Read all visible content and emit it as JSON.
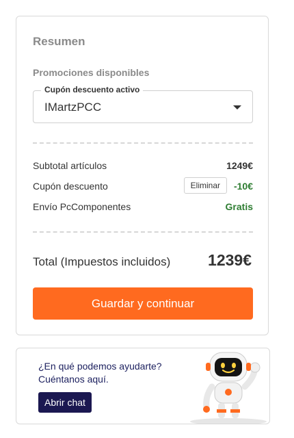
{
  "summary": {
    "title": "Resumen",
    "promotions_label": "Promociones disponibles",
    "coupon_select": {
      "legend": "Cupón descuento activo",
      "value": "IMartzPCC",
      "caret_icon": "chevron-down-icon"
    },
    "rows": {
      "subtotal": {
        "label": "Subtotal artículos",
        "value": "1249€"
      },
      "coupon": {
        "label": "Cupón descuento",
        "remove_label": "Eliminar",
        "value": "-10€"
      },
      "shipping": {
        "label": "Envío PcComponentes",
        "value": "Gratis"
      }
    },
    "total": {
      "label": "Total (Impuestos incluidos)",
      "value": "1239€"
    },
    "cta_label": "Guardar y continuar"
  },
  "help": {
    "question": "¿En qué podemos ayudarte?",
    "subtitle": "Cuéntanos aquí.",
    "chat_button": "Abrir chat",
    "mascot_icon": "robot-mascot-icon"
  },
  "colors": {
    "accent": "#ff6a1f",
    "positive": "#2e7d32",
    "chat_button": "#1b1851"
  }
}
